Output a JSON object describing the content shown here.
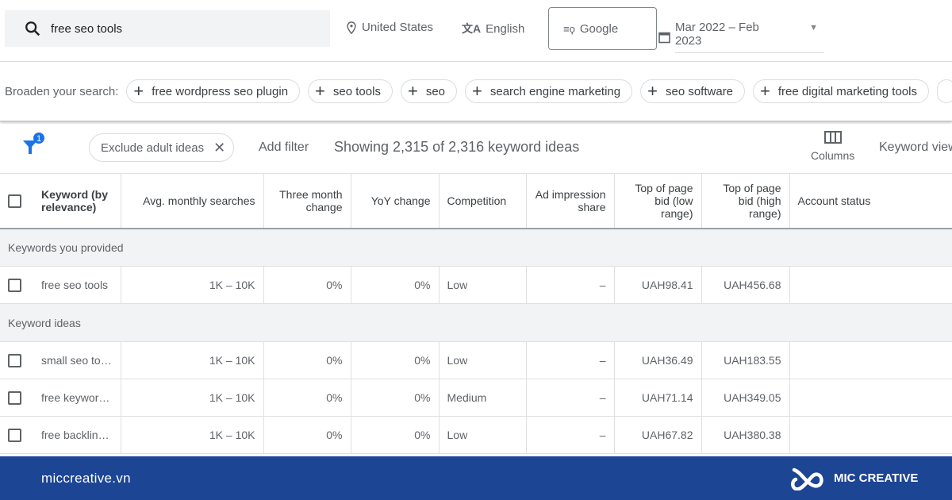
{
  "header": {
    "search_value": "free seo tools",
    "location": "United States",
    "language": "English",
    "network": "Google",
    "date_range": "Mar 2022 – Feb 2023"
  },
  "broaden": {
    "label": "Broaden your search:",
    "chips": [
      "free wordpress seo plugin",
      "seo tools",
      "seo",
      "search engine marketing",
      "seo software",
      "free digital marketing tools"
    ]
  },
  "filterbar": {
    "filter_count": "1",
    "exclude_chip": "Exclude adult ideas",
    "add_filter": "Add filter",
    "showing": "Showing 2,315 of 2,316 keyword ideas",
    "columns": "Columns",
    "keyword_view": "Keyword view"
  },
  "table": {
    "headers": [
      "Keyword (by relevance)",
      "Avg. monthly searches",
      "Three month change",
      "YoY change",
      "Competition",
      "Ad impression share",
      "Top of page bid (low range)",
      "Top of page bid (high range)",
      "Account status"
    ],
    "group1": "Keywords you provided",
    "provided": [
      [
        "free seo tools",
        "1K – 10K",
        "0%",
        "0%",
        "Low",
        "–",
        "UAH98.41",
        "UAH456.68",
        ""
      ]
    ],
    "group2": "Keyword ideas",
    "ideas": [
      [
        "small seo tools",
        "1K – 10K",
        "0%",
        "0%",
        "Low",
        "–",
        "UAH36.49",
        "UAH183.55",
        ""
      ],
      [
        "free keyword tool",
        "1K – 10K",
        "0%",
        "0%",
        "Medium",
        "–",
        "UAH71.14",
        "UAH349.05",
        ""
      ],
      [
        "free backlink checker",
        "1K – 10K",
        "0%",
        "0%",
        "Low",
        "–",
        "UAH67.82",
        "UAH380.38",
        ""
      ]
    ]
  },
  "footer": {
    "site": "miccreative.vn",
    "brand": "MIC CREATIVE",
    "color": "#1c4594"
  }
}
